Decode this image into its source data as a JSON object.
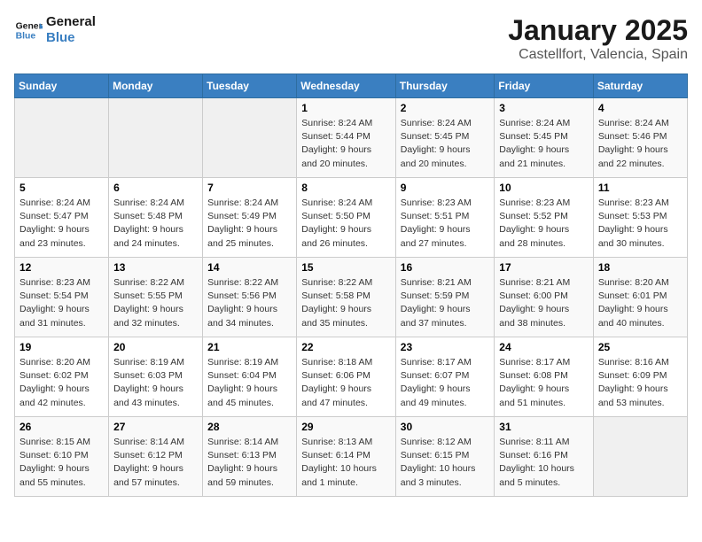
{
  "logo": {
    "text_general": "General",
    "text_blue": "Blue"
  },
  "title": "January 2025",
  "subtitle": "Castellfort, Valencia, Spain",
  "days_of_week": [
    "Sunday",
    "Monday",
    "Tuesday",
    "Wednesday",
    "Thursday",
    "Friday",
    "Saturday"
  ],
  "weeks": [
    [
      {
        "day": "",
        "info": ""
      },
      {
        "day": "",
        "info": ""
      },
      {
        "day": "",
        "info": ""
      },
      {
        "day": "1",
        "info": "Sunrise: 8:24 AM\nSunset: 5:44 PM\nDaylight: 9 hours\nand 20 minutes."
      },
      {
        "day": "2",
        "info": "Sunrise: 8:24 AM\nSunset: 5:45 PM\nDaylight: 9 hours\nand 20 minutes."
      },
      {
        "day": "3",
        "info": "Sunrise: 8:24 AM\nSunset: 5:45 PM\nDaylight: 9 hours\nand 21 minutes."
      },
      {
        "day": "4",
        "info": "Sunrise: 8:24 AM\nSunset: 5:46 PM\nDaylight: 9 hours\nand 22 minutes."
      }
    ],
    [
      {
        "day": "5",
        "info": "Sunrise: 8:24 AM\nSunset: 5:47 PM\nDaylight: 9 hours\nand 23 minutes."
      },
      {
        "day": "6",
        "info": "Sunrise: 8:24 AM\nSunset: 5:48 PM\nDaylight: 9 hours\nand 24 minutes."
      },
      {
        "day": "7",
        "info": "Sunrise: 8:24 AM\nSunset: 5:49 PM\nDaylight: 9 hours\nand 25 minutes."
      },
      {
        "day": "8",
        "info": "Sunrise: 8:24 AM\nSunset: 5:50 PM\nDaylight: 9 hours\nand 26 minutes."
      },
      {
        "day": "9",
        "info": "Sunrise: 8:23 AM\nSunset: 5:51 PM\nDaylight: 9 hours\nand 27 minutes."
      },
      {
        "day": "10",
        "info": "Sunrise: 8:23 AM\nSunset: 5:52 PM\nDaylight: 9 hours\nand 28 minutes."
      },
      {
        "day": "11",
        "info": "Sunrise: 8:23 AM\nSunset: 5:53 PM\nDaylight: 9 hours\nand 30 minutes."
      }
    ],
    [
      {
        "day": "12",
        "info": "Sunrise: 8:23 AM\nSunset: 5:54 PM\nDaylight: 9 hours\nand 31 minutes."
      },
      {
        "day": "13",
        "info": "Sunrise: 8:22 AM\nSunset: 5:55 PM\nDaylight: 9 hours\nand 32 minutes."
      },
      {
        "day": "14",
        "info": "Sunrise: 8:22 AM\nSunset: 5:56 PM\nDaylight: 9 hours\nand 34 minutes."
      },
      {
        "day": "15",
        "info": "Sunrise: 8:22 AM\nSunset: 5:58 PM\nDaylight: 9 hours\nand 35 minutes."
      },
      {
        "day": "16",
        "info": "Sunrise: 8:21 AM\nSunset: 5:59 PM\nDaylight: 9 hours\nand 37 minutes."
      },
      {
        "day": "17",
        "info": "Sunrise: 8:21 AM\nSunset: 6:00 PM\nDaylight: 9 hours\nand 38 minutes."
      },
      {
        "day": "18",
        "info": "Sunrise: 8:20 AM\nSunset: 6:01 PM\nDaylight: 9 hours\nand 40 minutes."
      }
    ],
    [
      {
        "day": "19",
        "info": "Sunrise: 8:20 AM\nSunset: 6:02 PM\nDaylight: 9 hours\nand 42 minutes."
      },
      {
        "day": "20",
        "info": "Sunrise: 8:19 AM\nSunset: 6:03 PM\nDaylight: 9 hours\nand 43 minutes."
      },
      {
        "day": "21",
        "info": "Sunrise: 8:19 AM\nSunset: 6:04 PM\nDaylight: 9 hours\nand 45 minutes."
      },
      {
        "day": "22",
        "info": "Sunrise: 8:18 AM\nSunset: 6:06 PM\nDaylight: 9 hours\nand 47 minutes."
      },
      {
        "day": "23",
        "info": "Sunrise: 8:17 AM\nSunset: 6:07 PM\nDaylight: 9 hours\nand 49 minutes."
      },
      {
        "day": "24",
        "info": "Sunrise: 8:17 AM\nSunset: 6:08 PM\nDaylight: 9 hours\nand 51 minutes."
      },
      {
        "day": "25",
        "info": "Sunrise: 8:16 AM\nSunset: 6:09 PM\nDaylight: 9 hours\nand 53 minutes."
      }
    ],
    [
      {
        "day": "26",
        "info": "Sunrise: 8:15 AM\nSunset: 6:10 PM\nDaylight: 9 hours\nand 55 minutes."
      },
      {
        "day": "27",
        "info": "Sunrise: 8:14 AM\nSunset: 6:12 PM\nDaylight: 9 hours\nand 57 minutes."
      },
      {
        "day": "28",
        "info": "Sunrise: 8:14 AM\nSunset: 6:13 PM\nDaylight: 9 hours\nand 59 minutes."
      },
      {
        "day": "29",
        "info": "Sunrise: 8:13 AM\nSunset: 6:14 PM\nDaylight: 10 hours\nand 1 minute."
      },
      {
        "day": "30",
        "info": "Sunrise: 8:12 AM\nSunset: 6:15 PM\nDaylight: 10 hours\nand 3 minutes."
      },
      {
        "day": "31",
        "info": "Sunrise: 8:11 AM\nSunset: 6:16 PM\nDaylight: 10 hours\nand 5 minutes."
      },
      {
        "day": "",
        "info": ""
      }
    ]
  ]
}
